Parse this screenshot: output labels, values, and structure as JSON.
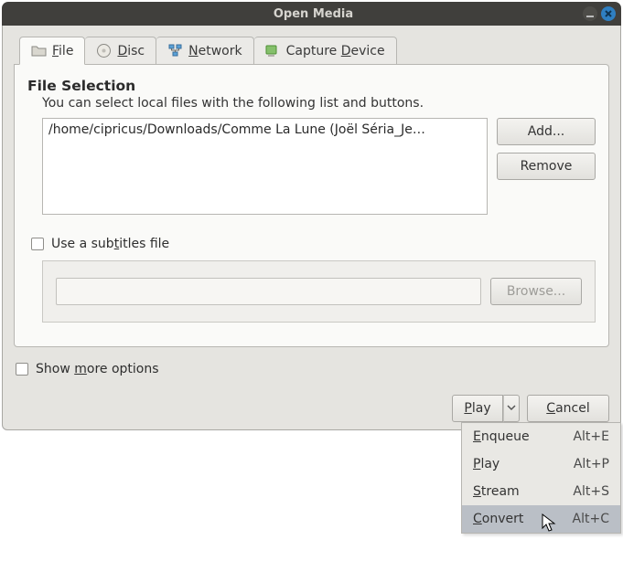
{
  "window": {
    "title": "Open Media"
  },
  "tabs": {
    "file": "File",
    "disc": "Disc",
    "network": "Network",
    "capture": "Capture Device"
  },
  "file_section": {
    "heading": "File Selection",
    "subtext": "You can select local files with the following list and buttons.",
    "selected_path": "/home/cipricus/Downloads/Comme La Lune (Joël Séria_Je…",
    "add_label": "Add...",
    "remove_label": "Remove"
  },
  "subtitles": {
    "checkbox_label": "Use a subtitles file",
    "browse_label": "Browse..."
  },
  "more_options_label": "Show more options",
  "actions": {
    "play": "Play",
    "cancel": "Cancel"
  },
  "play_menu": {
    "items": [
      {
        "label": "Enqueue",
        "shortcut": "Alt+E"
      },
      {
        "label": "Play",
        "shortcut": "Alt+P"
      },
      {
        "label": "Stream",
        "shortcut": "Alt+S"
      },
      {
        "label": "Convert",
        "shortcut": "Alt+C"
      }
    ],
    "hover_index": 3
  }
}
